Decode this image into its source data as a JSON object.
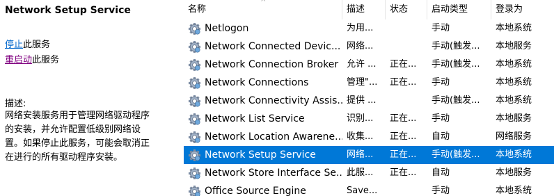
{
  "detail": {
    "title": "Network Setup Service",
    "stop_link": "停止",
    "stop_suffix": "此服务",
    "restart_link": "重启动",
    "restart_suffix": "此服务",
    "description_label": "描述:",
    "description_lines": [
      "网络安装服务用于管理网络驱动程序",
      "的安装，并允许配置低级别网络设",
      "置。如果停止此服务，可能会取消正",
      "在进行的所有驱动程序安装。"
    ]
  },
  "columns": {
    "name": "名称",
    "description": "描述",
    "status": "状态",
    "startup": "启动类型",
    "logon": "登录为"
  },
  "icons": {
    "service": "gear-icon",
    "sort": "sort-up-icon"
  },
  "colors": {
    "selected": "#0078d7",
    "stop_link": "#0066cc",
    "restart_link": "#800080"
  },
  "rows": [
    {
      "name": "Netlogon",
      "description": "为用...",
      "status": "",
      "startup": "手动",
      "logon": "本地系统",
      "selected": false
    },
    {
      "name": "Network Connected Devic...",
      "description": "网络...",
      "status": "",
      "startup": "手动(触发...",
      "logon": "本地服务",
      "selected": false
    },
    {
      "name": "Network Connection Broker",
      "description": "允许 ...",
      "status": "正在...",
      "startup": "手动(触发...",
      "logon": "本地系统",
      "selected": false
    },
    {
      "name": "Network Connections",
      "description": "管理\"...",
      "status": "正在...",
      "startup": "手动",
      "logon": "本地系统",
      "selected": false
    },
    {
      "name": "Network Connectivity Assis...",
      "description": "提供 ...",
      "status": "",
      "startup": "手动(触发...",
      "logon": "本地系统",
      "selected": false
    },
    {
      "name": "Network List Service",
      "description": "识别...",
      "status": "正在...",
      "startup": "手动",
      "logon": "本地服务",
      "selected": false
    },
    {
      "name": "Network Location Awarene...",
      "description": "收集...",
      "status": "正在...",
      "startup": "自动",
      "logon": "网络服务",
      "selected": false
    },
    {
      "name": "Network Setup Service",
      "description": "网络...",
      "status": "正在...",
      "startup": "手动(触发...",
      "logon": "本地系统",
      "selected": true
    },
    {
      "name": "Network Store Interface Se...",
      "description": "此服...",
      "status": "正在...",
      "startup": "自动",
      "logon": "本地服务",
      "selected": false
    },
    {
      "name": "Office Source Engine",
      "description": "Save...",
      "status": "",
      "startup": "手动",
      "logon": "本地系统",
      "selected": false
    }
  ]
}
